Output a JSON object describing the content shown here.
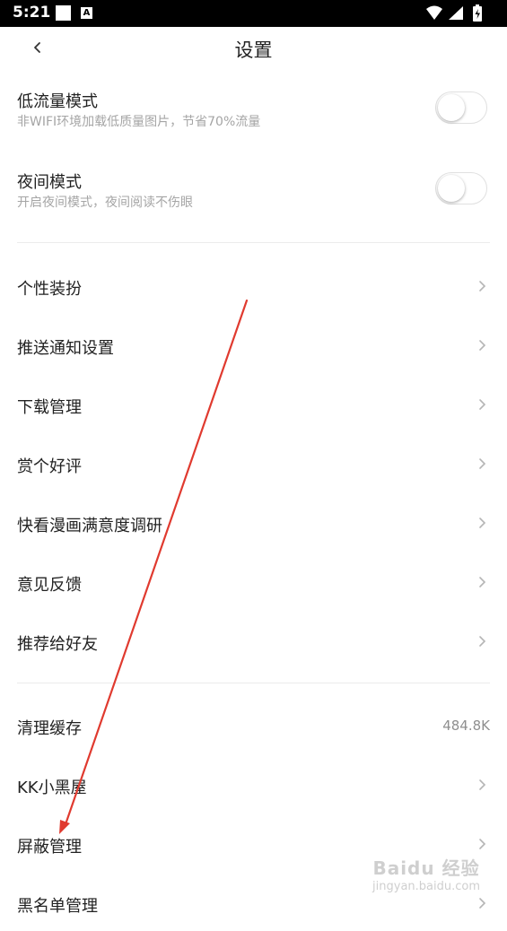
{
  "status_bar": {
    "time": "5:21",
    "a_label": "A"
  },
  "header": {
    "title": "设置"
  },
  "toggles": [
    {
      "title": "低流量模式",
      "subtitle": "非WIFI环境加载低质量图片，节省70%流量",
      "on": false
    },
    {
      "title": "夜间模式",
      "subtitle": "开启夜间模式，夜间阅读不伤眼",
      "on": false
    }
  ],
  "menu_group1": [
    {
      "label": "个性装扮"
    },
    {
      "label": "推送通知设置"
    },
    {
      "label": "下载管理"
    },
    {
      "label": "赏个好评"
    },
    {
      "label": "快看漫画满意度调研"
    },
    {
      "label": "意见反馈"
    },
    {
      "label": "推荐给好友"
    }
  ],
  "menu_group2": [
    {
      "label": "清理缓存",
      "value": "484.8K"
    },
    {
      "label": "KK小黑屋"
    },
    {
      "label": "屏蔽管理"
    },
    {
      "label": "黑名单管理"
    }
  ],
  "watermark": {
    "line1": "Baidu 经验",
    "line2": "jingyan.baidu.com"
  },
  "colors": {
    "annotation_arrow": "#e03a2f",
    "divider": "#ececec",
    "subtitle": "#a5a5a5"
  }
}
